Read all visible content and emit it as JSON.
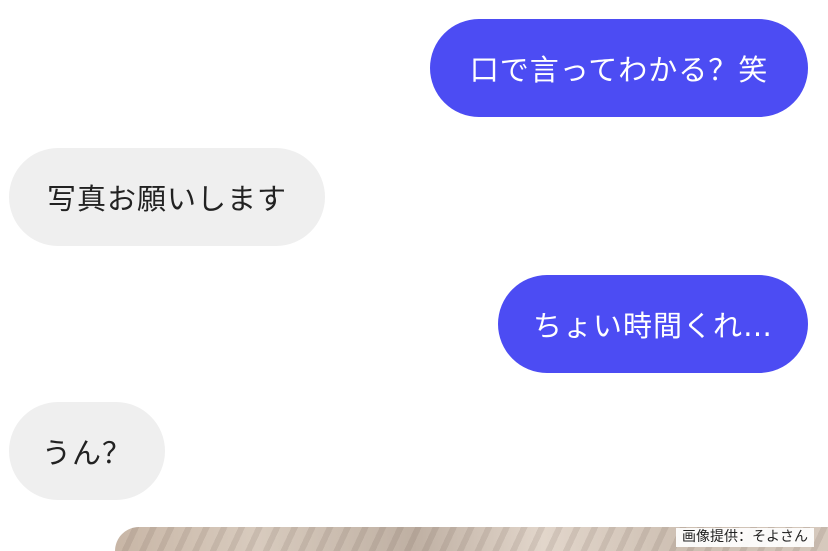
{
  "messages": [
    {
      "sender": "me",
      "text": "口で言ってわかる？笑"
    },
    {
      "sender": "other",
      "text": "写真お願いします"
    },
    {
      "sender": "me",
      "text": "ちょい時間くれ…"
    },
    {
      "sender": "other",
      "text": "うん？"
    }
  ],
  "image_credit": "画像提供：そよさん",
  "colors": {
    "sent_bubble": "#4c4cf3",
    "received_bubble": "#efefef",
    "background": "#ffffff"
  }
}
